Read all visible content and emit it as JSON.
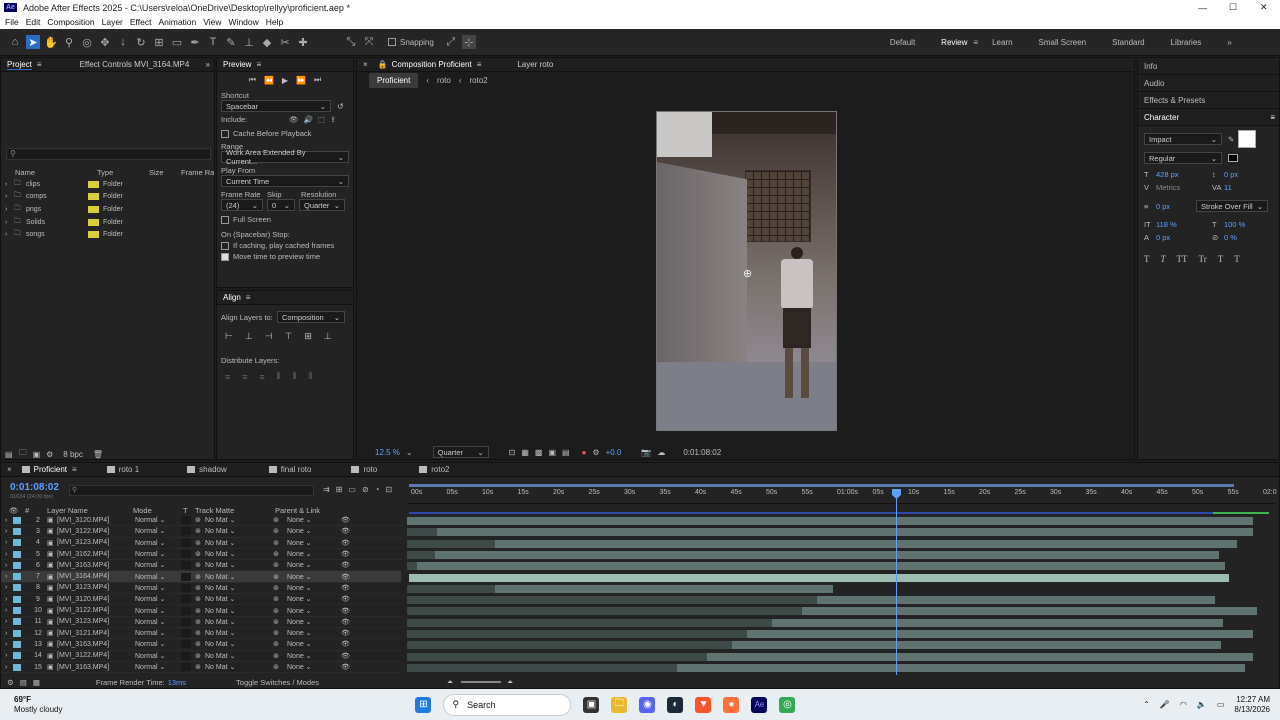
{
  "app": {
    "title": "Adobe After Effects 2025 - C:\\Users\\reloa\\OneDrive\\Desktop\\rellyy\\proficient.aep *",
    "logo": "Ae"
  },
  "menu": [
    "File",
    "Edit",
    "Composition",
    "Layer",
    "Effect",
    "Animation",
    "View",
    "Window",
    "Help"
  ],
  "toolbar": {
    "snapping": "Snapping",
    "workspaces": [
      "Default",
      "Review",
      "Learn",
      "Small Screen",
      "Standard",
      "Libraries"
    ],
    "active_workspace": "Review"
  },
  "project": {
    "tab": "Project",
    "effect_tab": "Effect Controls MVI_3164.MP4",
    "columns": [
      "Name",
      "Type",
      "Size",
      "Frame Ra"
    ],
    "items": [
      {
        "name": "clips",
        "type": "Folder"
      },
      {
        "name": "comps",
        "type": "Folder"
      },
      {
        "name": "pngs",
        "type": "Folder"
      },
      {
        "name": "Solids",
        "type": "Folder"
      },
      {
        "name": "songs",
        "type": "Folder"
      }
    ],
    "bpc": "8 bpc"
  },
  "preview": {
    "tab": "Preview",
    "shortcut_label": "Shortcut",
    "shortcut": "Spacebar",
    "include": "Include:",
    "cache": "Cache Before Playback",
    "range_label": "Range",
    "range": "Work Area Extended By Current...",
    "play_from_label": "Play From",
    "play_from": "Current Time",
    "frame_rate_label": "Frame Rate",
    "skip_label": "Skip",
    "resolution_label": "Resolution",
    "frame_rate": "(24)",
    "skip": "0",
    "resolution": "Quarter",
    "full_screen": "Full Screen",
    "stop_label": "On (Spacebar) Stop:",
    "caching": "If caching, play cached frames",
    "move_time": "Move time to preview time"
  },
  "align": {
    "tab": "Align",
    "align_to_label": "Align Layers to:",
    "align_to": "Composition",
    "distribute": "Distribute Layers:"
  },
  "comp": {
    "tab": "Composition Proficient",
    "layer_tab": "Layer roto",
    "breadcrumbs": [
      "Proficient",
      "roto",
      "roto2"
    ],
    "zoom": "12.5 %",
    "quality": "Quarter",
    "exposure": "+0.0",
    "timecode": "0:01:08:02"
  },
  "right": {
    "info": "Info",
    "audio": "Audio",
    "effects": "Effects & Presets",
    "character": "Character",
    "font": "Impact",
    "style": "Regular",
    "size": "428 px",
    "kerning": "Metrics",
    "leading": "0 px",
    "tracking": "11",
    "stroke": "0 px",
    "stroke_mode": "Stroke Over Fill",
    "vscale": "118 %",
    "hscale": "100 %",
    "baseline": "0 px",
    "tsume": "0 %",
    "text_styles": [
      "T",
      "T",
      "TT",
      "Tr",
      "T",
      "T"
    ]
  },
  "timeline": {
    "tabs": [
      "Proficient",
      "roto 1",
      "shadow",
      "final roto",
      "roto",
      "roto2"
    ],
    "timecode": "0:01:08:02",
    "fps_note": "01634 (24.00 fps)",
    "columns": [
      "#",
      "Layer Name",
      "Mode",
      "T",
      "Track Matte",
      "Parent & Link"
    ],
    "ruler": [
      "00s",
      "05s",
      "10s",
      "15s",
      "20s",
      "25s",
      "30s",
      "35s",
      "40s",
      "45s",
      "50s",
      "55s",
      "01:00s",
      "05s",
      "10s",
      "15s",
      "20s",
      "25s",
      "30s",
      "35s",
      "40s",
      "45s",
      "50s",
      "55s",
      "02:0"
    ],
    "layers": [
      {
        "num": "2",
        "name": "[MVI_3120.MP4]",
        "mode": "Normal",
        "matte": "No Mat",
        "parent": "None"
      },
      {
        "num": "3",
        "name": "[MVI_3122.MP4]",
        "mode": "Normal",
        "matte": "No Mat",
        "parent": "None"
      },
      {
        "num": "4",
        "name": "[MVI_3123.MP4]",
        "mode": "Normal",
        "matte": "No Mat",
        "parent": "None"
      },
      {
        "num": "5",
        "name": "[MVI_3162.MP4]",
        "mode": "Normal",
        "matte": "No Mat",
        "parent": "None"
      },
      {
        "num": "6",
        "name": "[MVI_3163.MP4]",
        "mode": "Normal",
        "matte": "No Mat",
        "parent": "None"
      },
      {
        "num": "7",
        "name": "[MVI_3164.MP4]",
        "mode": "Normal",
        "matte": "No Mat",
        "parent": "None"
      },
      {
        "num": "8",
        "name": "[MVI_3123.MP4]",
        "mode": "Normal",
        "matte": "No Mat",
        "parent": "None"
      },
      {
        "num": "9",
        "name": "[MVI_3120.MP4]",
        "mode": "Normal",
        "matte": "No Mat",
        "parent": "None"
      },
      {
        "num": "10",
        "name": "[MVI_3122.MP4]",
        "mode": "Normal",
        "matte": "No Mat",
        "parent": "None"
      },
      {
        "num": "11",
        "name": "[MVI_3123.MP4]",
        "mode": "Normal",
        "matte": "No Mat",
        "parent": "None"
      },
      {
        "num": "12",
        "name": "[MVI_3121.MP4]",
        "mode": "Normal",
        "matte": "No Mat",
        "parent": "None"
      },
      {
        "num": "13",
        "name": "[MVI_3163.MP4]",
        "mode": "Normal",
        "matte": "No Mat",
        "parent": "None"
      },
      {
        "num": "14",
        "name": "[MVI_3122.MP4]",
        "mode": "Normal",
        "matte": "No Mat",
        "parent": "None"
      },
      {
        "num": "15",
        "name": "[MVI_3163.MP4]",
        "mode": "Normal",
        "matte": "No Mat",
        "parent": "None"
      }
    ],
    "render_time_label": "Frame Render Time:",
    "render_time": "13ms",
    "toggle": "Toggle Switches / Modes"
  },
  "taskbar": {
    "temp": "69°F",
    "weather": "Mostly cloudy",
    "search": "Search",
    "time": "12:27 AM",
    "date": "8/13/2026"
  }
}
